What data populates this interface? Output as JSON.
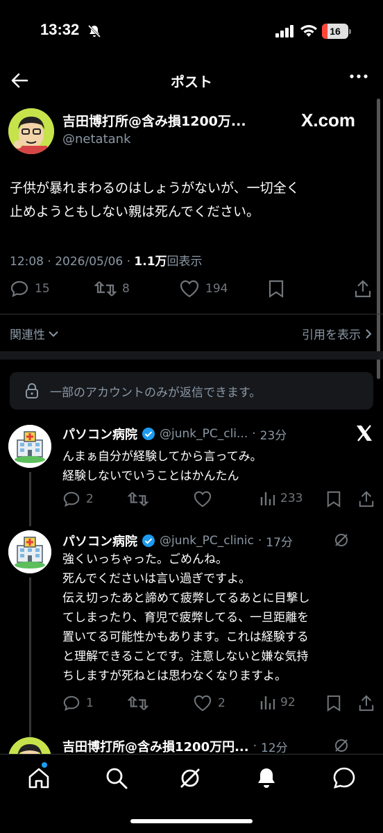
{
  "status_bar": {
    "time": "13:32",
    "battery": "16"
  },
  "header": {
    "title": "ポスト"
  },
  "post": {
    "author_name": "吉田博打所@含み損1200万...",
    "author_handle": "@netatank",
    "source_logo": "X.com",
    "text_line1": "子供が暴れまわるのはしょうがないが、一切全く",
    "text_line2": "止めようともしない親は死んでください。",
    "time": "12:08",
    "date": "2026/05/06",
    "views": "1.1万",
    "views_suffix": "回表示",
    "replies": "15",
    "reposts": "8",
    "likes": "194"
  },
  "filters": {
    "sort_label": "関連性",
    "quotes_label": "引用を表示"
  },
  "restricted_notice": "一部のアカウントのみが返信できます。",
  "replies": [
    {
      "name": "パソコン病院",
      "handle": "@junk_PC_cli...",
      "time": "23分",
      "text": "んまぁ自分が経験してから言ってみ。\n経験しないでいうことはかんたん",
      "replies": "2",
      "reposts": "",
      "likes": "",
      "views": "233",
      "badge_icon": "x-logo-icon"
    },
    {
      "name": "パソコン病院",
      "handle": "@junk_PC_clinic",
      "time": "17分",
      "text": "強くいっちゃった。ごめんね。\n死んでくださいは言い過ぎですよ。\n伝え切ったあと諦めて疲弊してるあとに目撃し\nてしまったり、育児で疲弊してる、一旦距離を\n置いてる可能性かもあります。これは経験する\nと理解できることです。注意しないと嫌な気持\nちしますが死ねとは思わなくなりますよ。",
      "replies": "1",
      "reposts": "",
      "likes": "2",
      "views": "92",
      "badge_icon": "grok-icon"
    },
    {
      "name": "吉田博打所@含み損1200万円...",
      "handle": "",
      "time": "12分",
      "badge_icon": "grok-icon"
    }
  ],
  "colors": {
    "accent": "#1d9bf0",
    "muted": "#71767b",
    "background": "#000000"
  }
}
